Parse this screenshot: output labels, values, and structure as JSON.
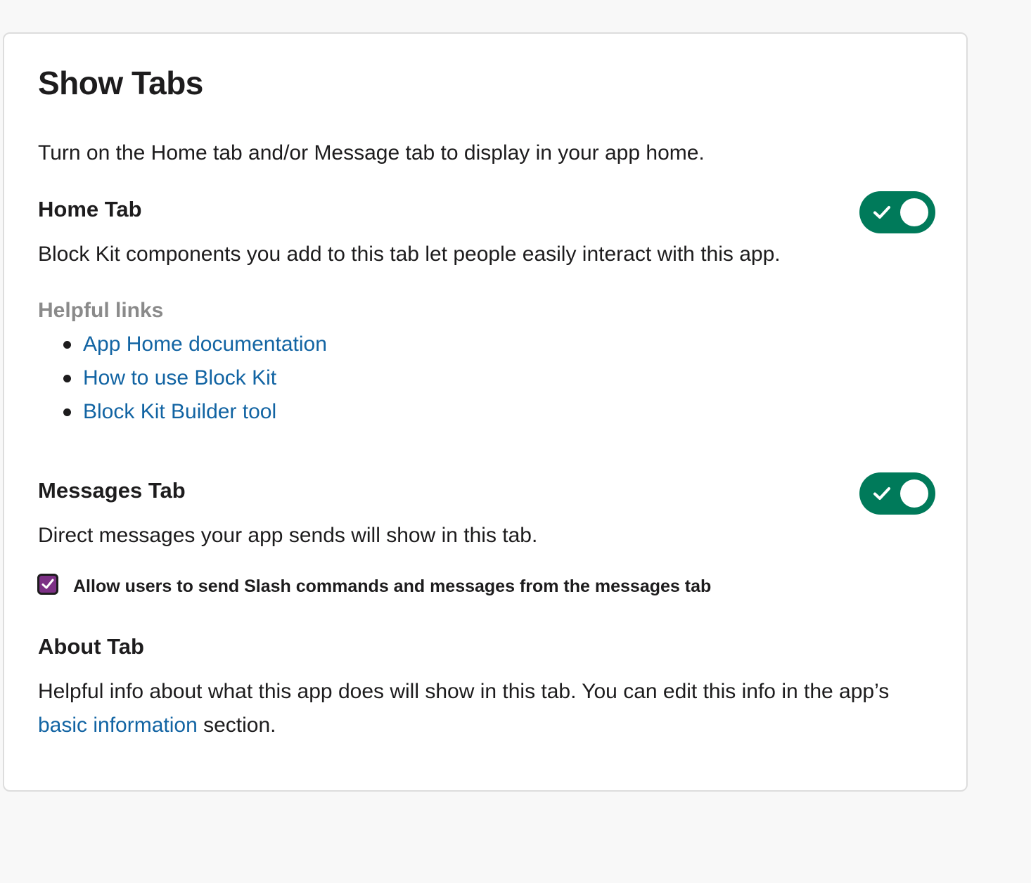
{
  "panel": {
    "title": "Show Tabs",
    "intro": "Turn on the Home tab and/or Message tab to display in your app home."
  },
  "home_tab": {
    "heading": "Home Tab",
    "enabled": true,
    "description": "Block Kit components you add to this tab let people easily interact with this app.",
    "helpful_links_label": "Helpful links",
    "links": [
      {
        "label": "App Home documentation"
      },
      {
        "label": "How to use Block Kit"
      },
      {
        "label": "Block Kit Builder tool"
      }
    ]
  },
  "messages_tab": {
    "heading": "Messages Tab",
    "enabled": true,
    "description": "Direct messages your app sends will show in this tab.",
    "allow_slash_commands": {
      "checked": true,
      "label": "Allow users to send Slash commands and messages from the messages tab"
    }
  },
  "about_tab": {
    "heading": "About Tab",
    "description_part1": "Helpful info about what this app does will show in this tab. You can edit this info in the app’s ",
    "description_link": "basic information",
    "description_part2": " section."
  },
  "colors": {
    "toggle_on": "#007a5a",
    "link": "#1264a3",
    "checkbox_checked": "#7c3085",
    "muted_label": "#8a8a8a"
  },
  "icons": {
    "toggle_check": "check-icon",
    "checkbox_check": "checkmark-icon"
  }
}
